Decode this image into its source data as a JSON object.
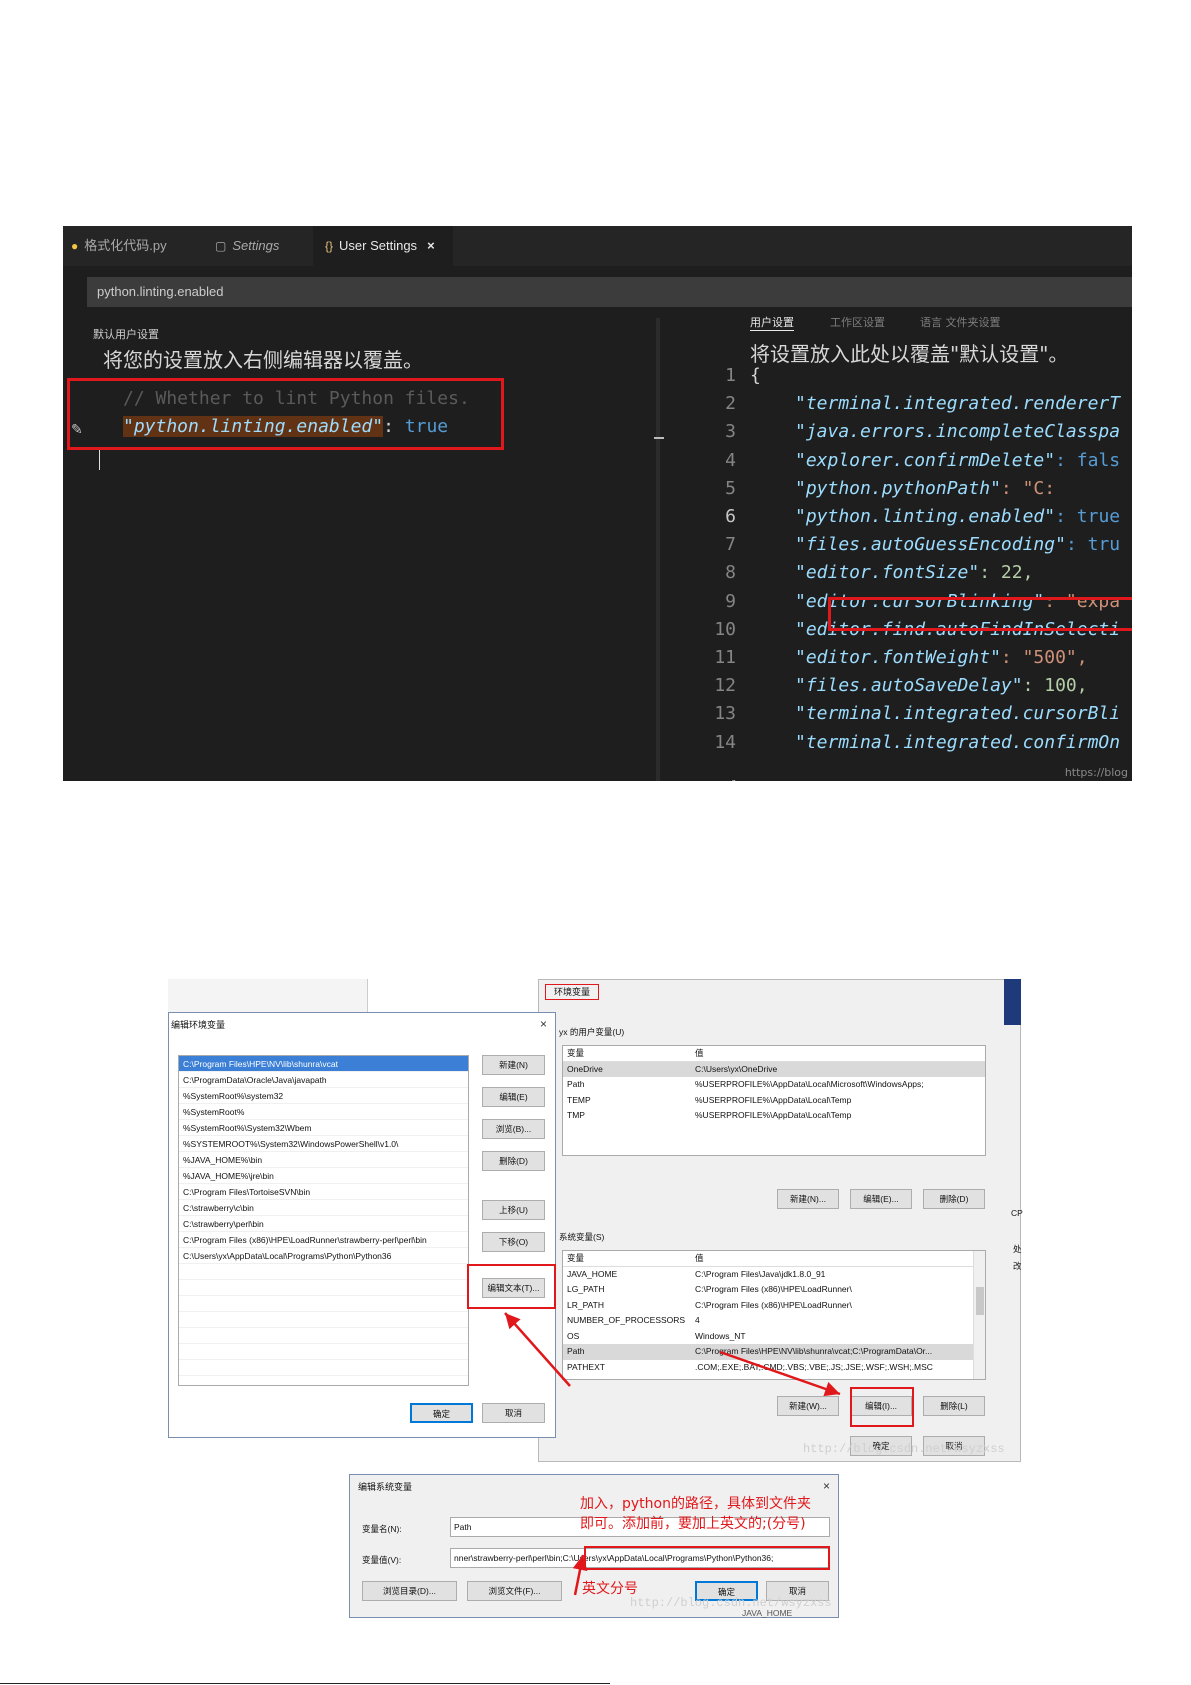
{
  "vscode": {
    "tabs": [
      {
        "label": "格式化代码.py"
      },
      {
        "label": "Settings"
      },
      {
        "label": "User Settings"
      }
    ],
    "close_glyph": "×",
    "search_value": "python.linting.enabled",
    "left_pane": {
      "subtitle": "默认用户设置",
      "hint": "将您的设置放入右侧编辑器以覆盖。",
      "comment": "// Whether to lint Python files.",
      "key": "\"python.linting.enabled\"",
      "value": "true"
    },
    "right_pane": {
      "tabs": [
        "用户设置",
        "工作区设置",
        "语言 文件夹设置"
      ],
      "hint": "将设置放入此处以覆盖\"默认设置\"。",
      "line_numbers": [
        "1",
        "2",
        "3",
        "4",
        "5",
        "6",
        "7",
        "8",
        "9",
        "10",
        "11",
        "12",
        "13",
        "14"
      ],
      "lines": [
        {
          "key": "{",
          "val": ""
        },
        {
          "key": "\"terminal.integrated.rendererT",
          "val": ""
        },
        {
          "key": "\"java.errors.incompleteClasspa",
          "val": ""
        },
        {
          "key": "\"explorer.confirmDelete\"",
          "val": ": fals"
        },
        {
          "key": "\"python.pythonPath\"",
          "val": ": \"C:"
        },
        {
          "key": "\"python.linting.enabled\"",
          "val": ": true"
        },
        {
          "key": "\"files.autoGuessEncoding\"",
          "val": ": tru"
        },
        {
          "key": "\"editor.fontSize\"",
          "val": ": 22,"
        },
        {
          "key": "\"editor.cursorBlinking\"",
          "val": ": \"expa"
        },
        {
          "key": "\"editor.find.autoFindInSelecti",
          "val": ""
        },
        {
          "key": "\"editor.fontWeight\"",
          "val": ": \"500\","
        },
        {
          "key": "\"files.autoSaveDelay\"",
          "val": ": 100,"
        },
        {
          "key": "\"terminal.integrated.cursorBli",
          "val": ""
        },
        {
          "key": "\"terminal.integrated.confirmOn",
          "val": ""
        }
      ],
      "watermark": "https://blog"
    }
  },
  "edit_env_dialog": {
    "title": "编辑环境变量",
    "close": "×",
    "paths": [
      "C:\\Program Files\\HPE\\NV\\lib\\shunra\\vcat",
      "C:\\ProgramData\\Oracle\\Java\\javapath",
      "%SystemRoot%\\system32",
      "%SystemRoot%",
      "%SystemRoot%\\System32\\Wbem",
      "%SYSTEMROOT%\\System32\\WindowsPowerShell\\v1.0\\",
      "%JAVA_HOME%\\bin",
      "%JAVA_HOME%\\jre\\bin",
      "C:\\Program Files\\TortoiseSVN\\bin",
      "C:\\strawberry\\c\\bin",
      "C:\\strawberry\\perl\\bin",
      "C:\\Program Files (x86)\\HPE\\LoadRunner\\strawberry-perl\\perl\\bin",
      "C:\\Users\\yx\\AppData\\Local\\Programs\\Python\\Python36"
    ],
    "buttons": {
      "new": "新建(N)",
      "edit": "编辑(E)",
      "browse": "浏览(B)...",
      "delete": "删除(D)",
      "up": "上移(U)",
      "down": "下移(O)",
      "edit_text": "编辑文本(T)...",
      "ok": "确定",
      "cancel": "取消"
    }
  },
  "env_dialog": {
    "title": "环境变量",
    "close": "×",
    "user_group": "yx 的用户变量(U)",
    "col_var": "变量",
    "col_val": "值",
    "user_vars": [
      {
        "name": "OneDrive",
        "value": "C:\\Users\\yx\\OneDrive"
      },
      {
        "name": "Path",
        "value": "%USERPROFILE%\\AppData\\Local\\Microsoft\\WindowsApps;"
      },
      {
        "name": "TEMP",
        "value": "%USERPROFILE%\\AppData\\Local\\Temp"
      },
      {
        "name": "TMP",
        "value": "%USERPROFILE%\\AppData\\Local\\Temp"
      }
    ],
    "user_buttons": {
      "new": "新建(N)...",
      "edit": "编辑(E)...",
      "delete": "删除(D)"
    },
    "sys_group": "系统变量(S)",
    "sys_vars": [
      {
        "name": "JAVA_HOME",
        "value": "C:\\Program Files\\Java\\jdk1.8.0_91"
      },
      {
        "name": "LG_PATH",
        "value": "C:\\Program Files (x86)\\HPE\\LoadRunner\\"
      },
      {
        "name": "LR_PATH",
        "value": "C:\\Program Files (x86)\\HPE\\LoadRunner\\"
      },
      {
        "name": "NUMBER_OF_PROCESSORS",
        "value": "4"
      },
      {
        "name": "OS",
        "value": "Windows_NT"
      },
      {
        "name": "Path",
        "value": "C:\\Program Files\\HPE\\NV\\lib\\shunra\\vcat;C:\\ProgramData\\Or..."
      },
      {
        "name": "PATHEXT",
        "value": ".COM;.EXE;.BAT;.CMD;.VBS;.VBE;.JS;.JSE;.WSF;.WSH;.MSC"
      }
    ],
    "sys_buttons": {
      "new": "新建(W)...",
      "edit": "编辑(I)...",
      "delete": "删除(L)"
    },
    "ok": "确定",
    "cancel": "取消",
    "side_text": [
      "CP",
      "处",
      "改"
    ]
  },
  "sys_var_dialog": {
    "title": "编辑系统变量",
    "close": "×",
    "name_label": "变量名(N):",
    "name_value": "Path",
    "value_label": "变量值(V):",
    "value_value": "nner\\strawberry-perl\\perl\\bin;C:\\Users\\yx\\AppData\\Local\\Programs\\Python\\Python36;",
    "browse_dir": "浏览目录(D)...",
    "browse_file": "浏览文件(F)...",
    "ok": "确定",
    "cancel": "取消",
    "below_text": "JAVA_HOME"
  },
  "annotations": {
    "add_path": "加入，python的路径，具体到文件夹",
    "add_path_2": "即可。添加前，要加上英文的;(分号)",
    "semicolon": "英文分号"
  },
  "watermark_bottom": "http://blog.csdn.net/wsyzxss",
  "watermark_mid": "http://blog.csdn.net/wsyzxss",
  "colors": {
    "annotation_red": "#e0181b",
    "selection_blue": "#3b7fd6",
    "editor_bg": "#1e1e1e"
  }
}
